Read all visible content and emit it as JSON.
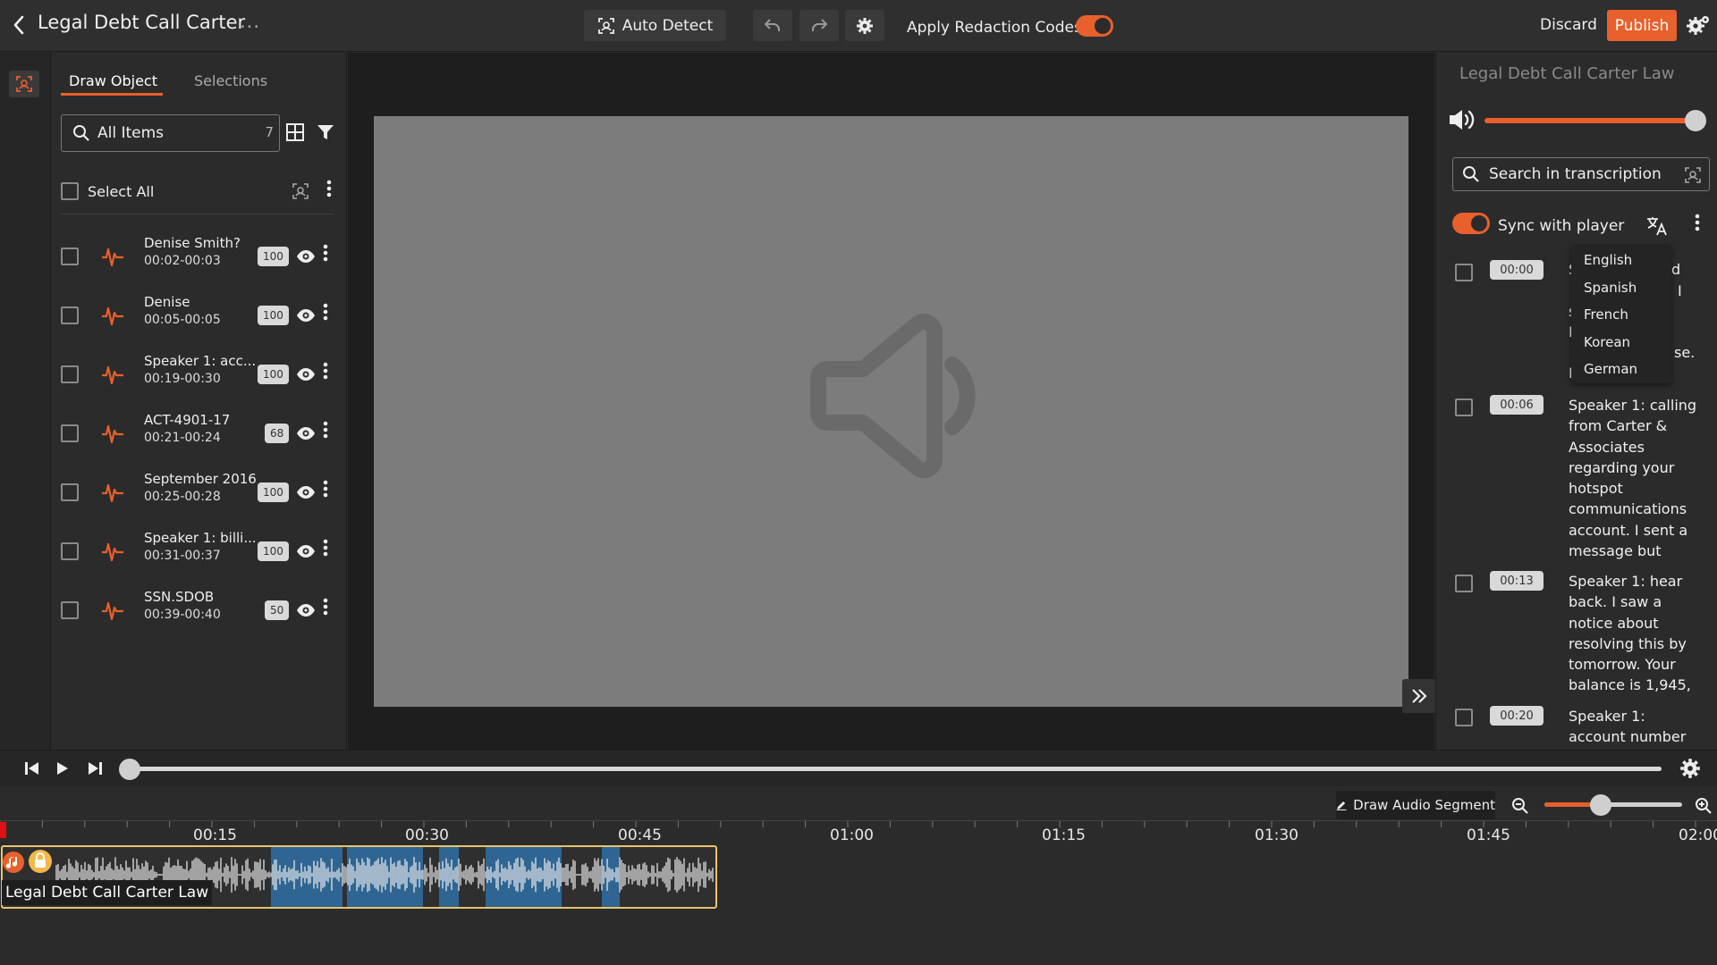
{
  "header": {
    "title": "Legal Debt Call Carter",
    "title_more": "...",
    "auto_detect_label": "Auto Detect",
    "apply_redaction_label": "Apply Redaction Codes",
    "discard_label": "Discard",
    "publish_label": "Publish",
    "apply_redaction_on": true
  },
  "left_panel": {
    "tabs": [
      {
        "label": "Draw Object",
        "active": true
      },
      {
        "label": "Selections",
        "active": false
      }
    ],
    "search_value": "All Items",
    "items_count": "7",
    "select_all_label": "Select All",
    "items": [
      {
        "name": "Denise Smith?",
        "time": "00:02-00:03",
        "score": "100"
      },
      {
        "name": "Denise",
        "time": "00:05-00:05",
        "score": "100"
      },
      {
        "name": "Speaker 1: acc...",
        "time": "00:19-00:30",
        "score": "100"
      },
      {
        "name": "ACT-4901-17",
        "time": "00:21-00:24",
        "score": "68"
      },
      {
        "name": "September 2016",
        "time": "00:25-00:28",
        "score": "100"
      },
      {
        "name": "Speaker 1: billi...",
        "time": "00:31-00:37",
        "score": "100"
      },
      {
        "name": "SSN.SDOB",
        "time": "00:39-00:40",
        "score": "50"
      }
    ]
  },
  "right_panel": {
    "title": "Legal Debt Call Carter Law",
    "volume_fraction": 1.0,
    "search_placeholder": "Search in transcription",
    "sync_label": "Sync with player",
    "sync_on": true,
    "languages": [
      "English",
      "Spanish",
      "French",
      "Korean",
      "German"
    ],
    "segments": [
      {
        "time": "00:00",
        "text": ""
      },
      {
        "time": "00:06",
        "text": "Speaker 1: calling from Carter & Associates regarding your hotspot communications account. I sent a message but"
      },
      {
        "time": "00:13",
        "text": "Speaker 1: hear back. I saw a notice about resolving this by tomorrow. Your balance is 1,945,"
      },
      {
        "time": "00:20",
        "text": "Speaker 1: account number"
      }
    ],
    "segment0_partial": [
      "S",
      "d",
      "I",
      "s",
      "I",
      "se.",
      "I"
    ]
  },
  "player": {
    "seek_fraction": 0.0
  },
  "timeline": {
    "draw_segment_label": "Draw Audio Segment",
    "zoom_fraction": 0.33,
    "tick_labels": [
      "00:15",
      "00:30",
      "00:45",
      "01:00",
      "01:15",
      "01:30",
      "01:45",
      "02:00"
    ],
    "clip_label": "Legal Debt Call Carter Law",
    "highlight_color": "#2f6fa3"
  },
  "colors": {
    "accent": "#e8602c",
    "clip_border": "#e7c46a"
  },
  "icons": {
    "back": "chevron-left-icon",
    "auto_detect": "face-scan-icon",
    "undo": "undo-icon",
    "redo": "redo-icon",
    "settings": "gear-icon",
    "top_right": "settings-gear-icon",
    "search": "search-icon",
    "grid": "grid-icon",
    "filter": "filter-icon",
    "eye": "eye-icon",
    "audio_item": "audio-wave-icon",
    "speaker": "speaker-icon",
    "translate": "translate-icon",
    "play": "play-icon",
    "draw": "pencil-icon"
  }
}
